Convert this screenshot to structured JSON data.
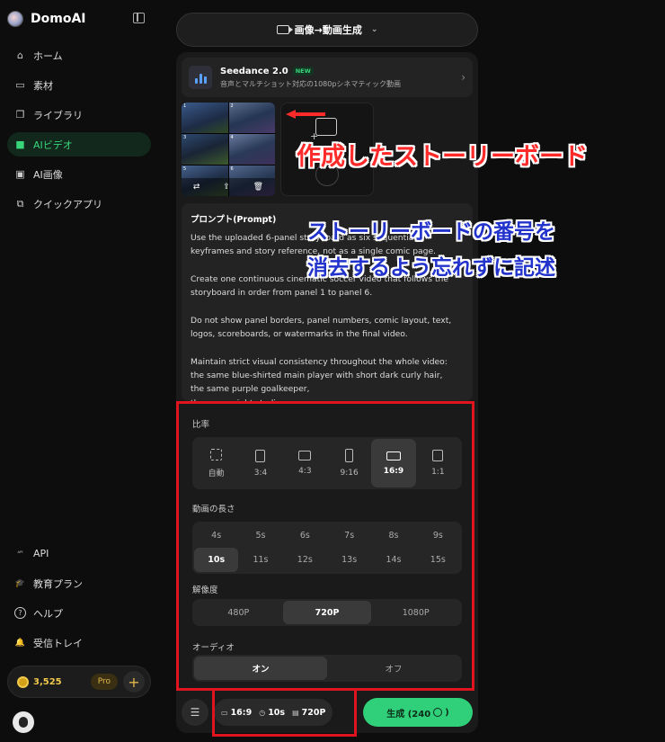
{
  "brand": {
    "name": "DomoAI"
  },
  "sidebar": {
    "items": [
      {
        "label": "ホーム",
        "icon": "home-icon",
        "glyph": "⌂"
      },
      {
        "label": "素材",
        "icon": "assets-icon",
        "glyph": "▭"
      },
      {
        "label": "ライブラリ",
        "icon": "library-icon",
        "glyph": "❐"
      },
      {
        "label": "AIビデオ",
        "icon": "video-icon",
        "glyph": "■"
      },
      {
        "label": "AI画像",
        "icon": "image-icon",
        "glyph": "▣"
      },
      {
        "label": "クイックアプリ",
        "icon": "quick-app-icon",
        "glyph": "⧉"
      }
    ],
    "active_index": 3,
    "bottom_items": [
      {
        "label": "API",
        "icon": "api-icon",
        "glyph": "ᴬᴾᴵ"
      },
      {
        "label": "教育プラン",
        "icon": "education-icon",
        "glyph": "🎓"
      },
      {
        "label": "ヘルプ",
        "icon": "help-icon",
        "glyph": "?"
      },
      {
        "label": "受信トレイ",
        "icon": "bell-icon",
        "glyph": "🔔"
      }
    ],
    "credits": "3,525",
    "plan": "Pro"
  },
  "mode": {
    "label": "画像→動画生成"
  },
  "model": {
    "name": "Seedance 2.0",
    "badge": "NEW",
    "description": "音声とマルチショット対応の1080pシネマティック動画"
  },
  "storyboard": {
    "panels": [
      "1",
      "2",
      "3",
      "4",
      "5",
      "6"
    ]
  },
  "prompt": {
    "title": "プロンプト(Prompt)",
    "text": "Use the uploaded 6-panel storyboard as six sequential\nkeyframes and story reference, not as a single comic page.\n\nCreate one continuous cinematic soccer video that follows the\nstoryboard in order from panel 1 to panel 6.\n\nDo not show panel borders, panel numbers, comic layout, text,\nlogos, scoreboards, or watermarks in the final video.\n\nMaintain strict visual consistency throughout the whole video:\nthe same blue-shirted main player with short dark curly hair,\nthe same purple goalkeeper,\nthe same night stadium,"
  },
  "settings": {
    "ratio_label": "比率",
    "ratios": [
      "自動",
      "3:4",
      "4:3",
      "9:16",
      "16:9",
      "1:1"
    ],
    "ratio_selected": 4,
    "duration_label": "動画の長さ",
    "durations": [
      "4s",
      "5s",
      "6s",
      "7s",
      "8s",
      "9s",
      "10s",
      "11s",
      "12s",
      "13s",
      "14s",
      "15s"
    ],
    "duration_selected": 6,
    "resolution_label": "解像度",
    "resolutions": [
      "480P",
      "720P",
      "1080P"
    ],
    "resolution_selected": 1,
    "audio_label": "オーディオ",
    "audio_options": [
      "オン",
      "オフ"
    ],
    "audio_selected": 0
  },
  "summary": {
    "ratio": "16:9",
    "duration": "10s",
    "resolution": "720P"
  },
  "generate": {
    "label": "生成 (240",
    "suffix": ")"
  },
  "annotations": {
    "red": "作成したストーリーボード",
    "blue_line1": "ストーリーボードの番号を",
    "blue_line2": "消去するよう忘れずに記述"
  },
  "colors": {
    "accent": "#2fd079",
    "annotation_red": "#e0141f",
    "annotation_blue": "#2233cc"
  }
}
